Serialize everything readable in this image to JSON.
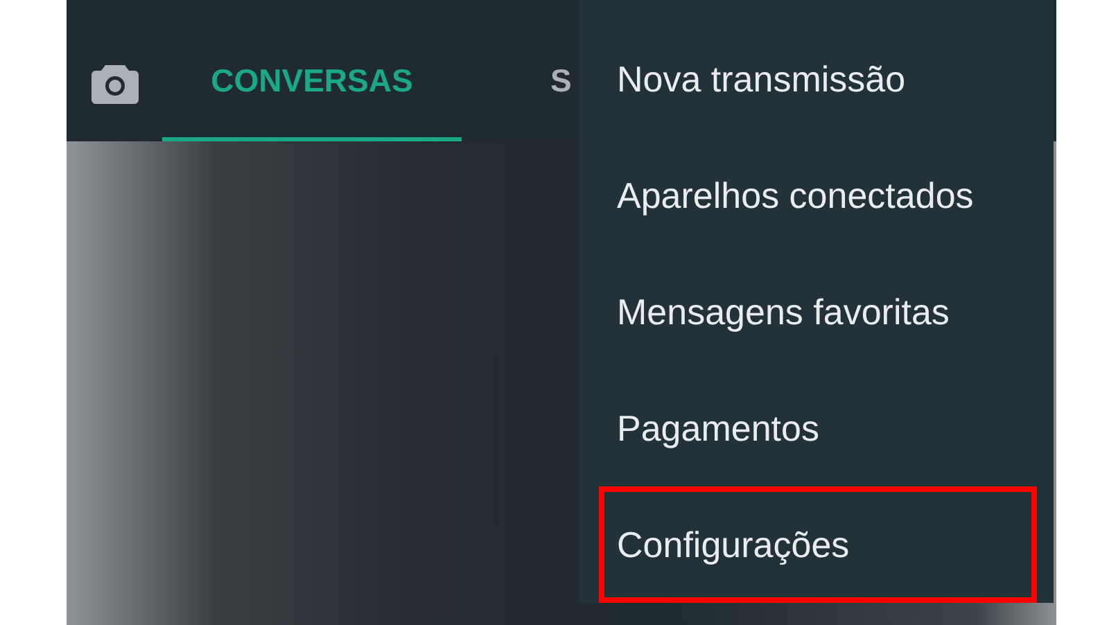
{
  "tabs": [
    {
      "label": "CONVERSAS",
      "selected": true
    },
    {
      "label": "S",
      "selected": false
    }
  ],
  "menu": {
    "items": [
      {
        "label": "Nova transmissão",
        "highlighted": false
      },
      {
        "label": "Aparelhos conectados",
        "highlighted": false
      },
      {
        "label": "Mensagens favoritas",
        "highlighted": false
      },
      {
        "label": "Pagamentos",
        "highlighted": false
      },
      {
        "label": "Configurações",
        "highlighted": true
      }
    ]
  }
}
